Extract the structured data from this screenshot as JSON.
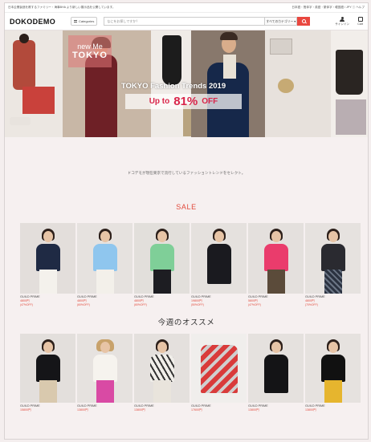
{
  "topbar": {
    "left": "日本企業製造を覆するファミリー・海事BHA より新しい展示品を公開しています。",
    "right": "日本語・簡体字・英語・繁体字・韓国語 / JPY   ⓘ ヘルプ"
  },
  "header": {
    "logo": "DOKODEMO",
    "categories_label": "Categories",
    "search_placeholder": "なにをお探しですか？",
    "search_scope": "すべてのカテゴリー ▾",
    "signin_label": "サインイン",
    "cart_label": "Cart"
  },
  "hero": {
    "badge_line1": "new Me",
    "badge_line2": "TOKYO",
    "title": "TOKYO Fashion Trends 2019",
    "sale_prefix": "Up to",
    "sale_value": "81%",
    "sale_suffix": "OFF"
  },
  "intro": "ドコデモが現在東京で流行しているファッショントレンドをセレクト。",
  "sale": {
    "title": "SALE",
    "items": [
      {
        "brand": "GUILD PRIME",
        "price": "4800円",
        "discount": "(47%OFF)"
      },
      {
        "brand": "GUILD PRIME",
        "price": "4800円",
        "discount": "(60%OFF)"
      },
      {
        "brand": "GUILD PRIME",
        "price": "4800円",
        "discount": "(60%OFF)"
      },
      {
        "brand": "GUILD PRIME",
        "price": "19800円",
        "discount": "(50%OFF)"
      },
      {
        "brand": "GUILD PRIME",
        "price": "5800円",
        "discount": "(47%OFF)"
      },
      {
        "brand": "GUILD PRIME",
        "price": "4800円",
        "discount": "(70%OFF)"
      }
    ]
  },
  "weekly": {
    "title": "今週のオススメ",
    "items": [
      {
        "brand": "GUILD PRIME",
        "price": "15800円"
      },
      {
        "brand": "GUILD PRIME",
        "price": "13800円"
      },
      {
        "brand": "GUILD PRIME",
        "price": "13800円"
      },
      {
        "brand": "GUILD PRIME",
        "price": "17600円"
      },
      {
        "brand": "GUILD PRIME",
        "price": "13800円"
      },
      {
        "brand": "GUILD PRIME",
        "price": "13800円"
      }
    ]
  },
  "colors": {
    "accent": "#e9473f",
    "sale_text": "#d9254a",
    "page_bg": "#f6f0f0"
  }
}
